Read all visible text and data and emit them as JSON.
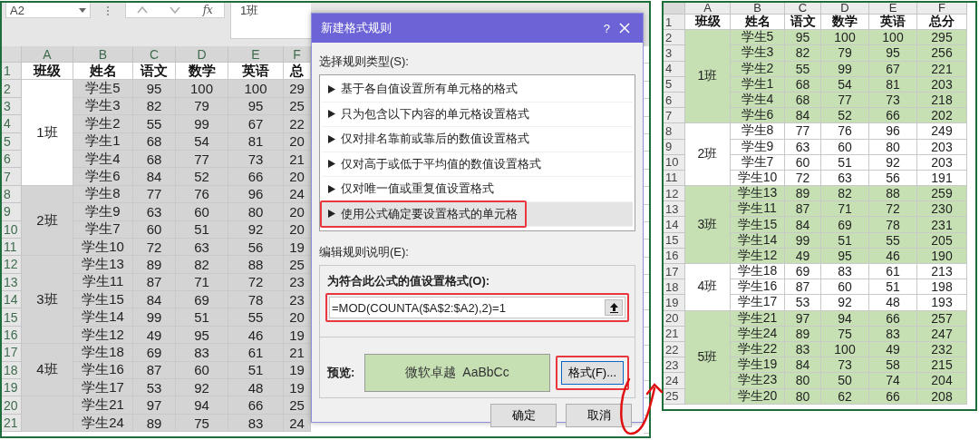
{
  "left_sheet": {
    "name_box": "A2",
    "formula_prefix": "fx",
    "formula_value": "1班",
    "columns": [
      "A",
      "B",
      "C",
      "D",
      "E",
      "F"
    ],
    "row_numbers": [
      "1",
      "2",
      "3",
      "4",
      "5",
      "6",
      "7",
      "8",
      "9",
      "10",
      "11",
      "12",
      "13",
      "14",
      "15",
      "16",
      "17",
      "18",
      "19",
      "20",
      "21"
    ],
    "header": [
      "班级",
      "姓名",
      "语文",
      "数学",
      "英语",
      "总"
    ],
    "groups": [
      {
        "label": "1班",
        "active": true,
        "rows": [
          [
            "学生5",
            "95",
            "100",
            "100",
            "29"
          ],
          [
            "学生3",
            "82",
            "79",
            "95",
            "25"
          ],
          [
            "学生2",
            "55",
            "99",
            "67",
            "22"
          ],
          [
            "学生1",
            "68",
            "54",
            "81",
            "20"
          ],
          [
            "学生4",
            "68",
            "77",
            "73",
            "21"
          ],
          [
            "学生6",
            "84",
            "52",
            "66",
            "20"
          ]
        ]
      },
      {
        "label": "2班",
        "active": false,
        "rows": [
          [
            "学生8",
            "77",
            "76",
            "96",
            "24"
          ],
          [
            "学生9",
            "63",
            "60",
            "80",
            "20"
          ],
          [
            "学生7",
            "60",
            "51",
            "92",
            "20"
          ],
          [
            "学生10",
            "72",
            "63",
            "56",
            "19"
          ]
        ]
      },
      {
        "label": "3班",
        "active": false,
        "rows": [
          [
            "学生13",
            "89",
            "82",
            "88",
            "25"
          ],
          [
            "学生11",
            "87",
            "71",
            "72",
            "23"
          ],
          [
            "学生15",
            "84",
            "69",
            "78",
            "23"
          ],
          [
            "学生14",
            "99",
            "51",
            "55",
            "20"
          ],
          [
            "学生12",
            "49",
            "95",
            "46",
            "19"
          ]
        ]
      },
      {
        "label": "4班",
        "active": false,
        "rows": [
          [
            "学生18",
            "69",
            "83",
            "61",
            "21"
          ],
          [
            "学生16",
            "87",
            "60",
            "51",
            "19"
          ],
          [
            "学生17",
            "53",
            "92",
            "48",
            "19"
          ]
        ]
      },
      {
        "active": false,
        "rows": [
          [
            "学生21",
            "97",
            "94",
            "66",
            "25"
          ],
          [
            "学生24",
            "89",
            "75",
            "83",
            "24"
          ]
        ]
      }
    ]
  },
  "dialog": {
    "title": "新建格式规则",
    "help": "?",
    "rule_type_label": "选择规则类型(S):",
    "rule_types": [
      {
        "label": "基于各自值设置所有单元格的格式",
        "selected": false,
        "annotated": false
      },
      {
        "label": "只为包含以下内容的单元格设置格式",
        "selected": false,
        "annotated": false
      },
      {
        "label": "仅对排名靠前或靠后的数值设置格式",
        "selected": false,
        "annotated": false
      },
      {
        "label": "仅对高于或低于平均值的数值设置格式",
        "selected": false,
        "annotated": false
      },
      {
        "label": "仅对唯一值或重复值设置格式",
        "selected": false,
        "annotated": false
      },
      {
        "label": "使用公式确定要设置格式的单元格",
        "selected": true,
        "annotated": true
      }
    ],
    "description_label": "编辑规则说明(E):",
    "formula_label": "为符合此公式的值设置格式(O):",
    "formula": {
      "value": "=MOD(COUNTA($A$2:$A2),2)=1",
      "annotated": true
    },
    "preview_label": "预览:",
    "preview_text": "微软卓越  AaBbCc",
    "format_button": {
      "label": "格式(F)...",
      "annotated": true
    },
    "buttons": [
      "确定",
      "取消"
    ]
  },
  "right_sheet": {
    "columns": [
      "A",
      "B",
      "C",
      "D",
      "E",
      "F"
    ],
    "row_numbers": [
      "1",
      "2",
      "3",
      "4",
      "5",
      "6",
      "7",
      "8",
      "9",
      "10",
      "11",
      "12",
      "13",
      "14",
      "15",
      "16",
      "17",
      "18",
      "19",
      "20",
      "21",
      "22",
      "23",
      "24",
      "25"
    ],
    "header": [
      "班级",
      "姓名",
      "语文",
      "数学",
      "英语",
      "总分"
    ],
    "groups": [
      {
        "label": "1班",
        "filled": true,
        "rows": [
          [
            "学生5",
            "95",
            "100",
            "100",
            "295"
          ],
          [
            "学生3",
            "82",
            "79",
            "95",
            "256"
          ],
          [
            "学生2",
            "55",
            "99",
            "67",
            "221"
          ],
          [
            "学生1",
            "68",
            "54",
            "81",
            "203"
          ],
          [
            "学生4",
            "68",
            "77",
            "73",
            "218"
          ],
          [
            "学生6",
            "84",
            "52",
            "66",
            "202"
          ]
        ]
      },
      {
        "label": "2班",
        "filled": false,
        "rows": [
          [
            "学生8",
            "77",
            "76",
            "96",
            "249"
          ],
          [
            "学生9",
            "63",
            "60",
            "80",
            "203"
          ],
          [
            "学生7",
            "60",
            "51",
            "92",
            "203"
          ],
          [
            "学生10",
            "72",
            "63",
            "56",
            "191"
          ]
        ]
      },
      {
        "label": "3班",
        "filled": true,
        "rows": [
          [
            "学生13",
            "89",
            "82",
            "88",
            "259"
          ],
          [
            "学生11",
            "87",
            "71",
            "72",
            "230"
          ],
          [
            "学生15",
            "84",
            "69",
            "78",
            "231"
          ],
          [
            "学生14",
            "99",
            "51",
            "55",
            "205"
          ],
          [
            "学生12",
            "49",
            "95",
            "46",
            "190"
          ]
        ]
      },
      {
        "label": "4班",
        "filled": false,
        "rows": [
          [
            "学生18",
            "69",
            "83",
            "61",
            "213"
          ],
          [
            "学生16",
            "87",
            "60",
            "51",
            "198"
          ],
          [
            "学生17",
            "53",
            "92",
            "48",
            "193"
          ]
        ]
      },
      {
        "label": "5班",
        "filled": true,
        "rows": [
          [
            "学生21",
            "97",
            "94",
            "66",
            "257"
          ],
          [
            "学生24",
            "89",
            "75",
            "83",
            "247"
          ],
          [
            "学生22",
            "83",
            "100",
            "49",
            "232"
          ],
          [
            "学生19",
            "84",
            "73",
            "58",
            "215"
          ],
          [
            "学生23",
            "80",
            "50",
            "74",
            "204"
          ],
          [
            "学生20",
            "80",
            "62",
            "66",
            "208"
          ]
        ]
      }
    ]
  }
}
